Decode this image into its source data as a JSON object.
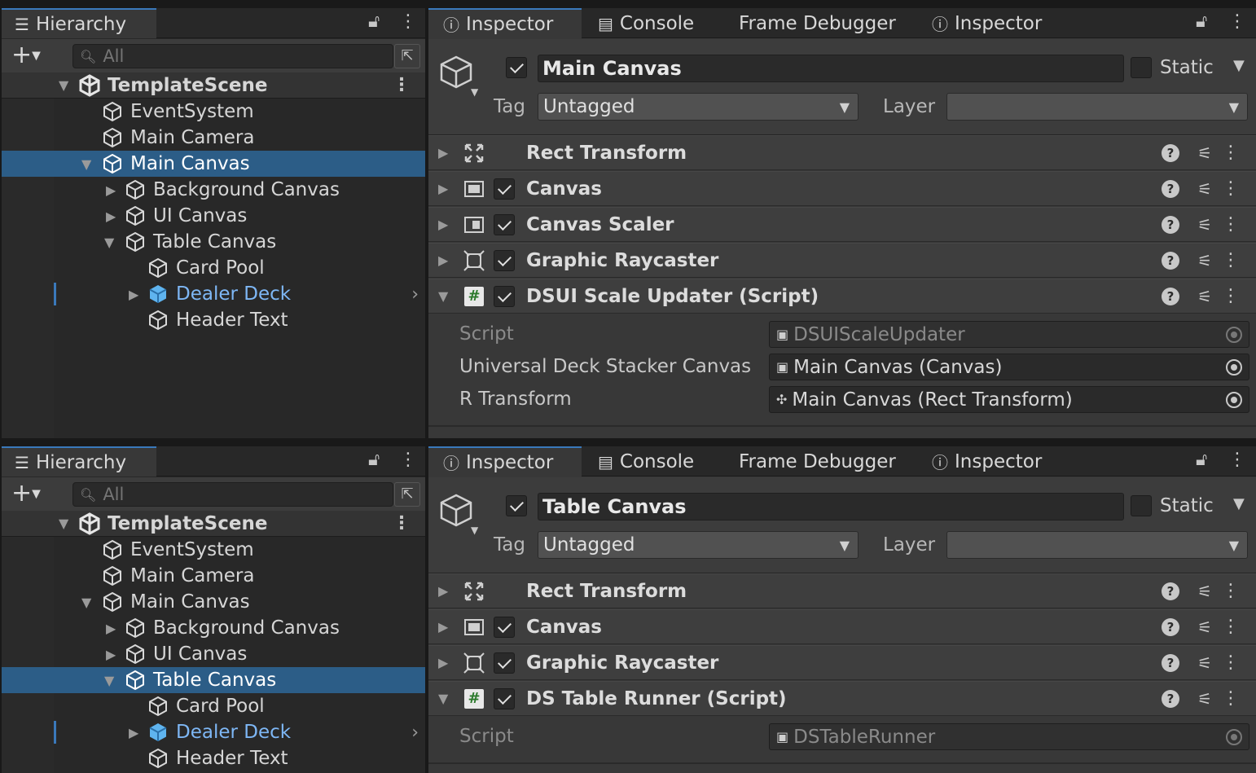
{
  "icons": {
    "hierarchy": "hierarchy-list-icon",
    "info": "info-icon",
    "console": "console-icon",
    "lock": "lock-icon",
    "kebab": "kebab-menu-icon",
    "cube": "gameobject-cube-icon",
    "unity": "unity-scene-icon"
  },
  "colors": {
    "selection": "#2c5d87",
    "prefab": "#7eb7f5",
    "tab_accent": "#3a79bb"
  },
  "panels": [
    {
      "hierarchy": {
        "tab": "Hierarchy",
        "search_placeholder": "All",
        "scene": "TemplateScene",
        "items": [
          {
            "label": "EventSystem"
          },
          {
            "label": "Main Camera"
          },
          {
            "label": "Main Canvas"
          },
          {
            "label": "Background Canvas"
          },
          {
            "label": "UI Canvas"
          },
          {
            "label": "Table Canvas"
          },
          {
            "label": "Card Pool"
          },
          {
            "label": "Dealer Deck"
          },
          {
            "label": "Header Text"
          }
        ]
      },
      "inspector": {
        "tabs": [
          "Inspector",
          "Console",
          "Frame Debugger",
          "Inspector"
        ],
        "object_name": "Main Canvas",
        "static_label": "Static",
        "tag_label": "Tag",
        "tag_value": "Untagged",
        "layer_label": "Layer",
        "layer_value": "",
        "components": [
          {
            "name": "Rect Transform"
          },
          {
            "name": "Canvas"
          },
          {
            "name": "Canvas Scaler"
          },
          {
            "name": "Graphic Raycaster"
          },
          {
            "name": "DSUI Scale Updater (Script)"
          }
        ],
        "properties": [
          {
            "label": "Script",
            "value": "DSUIScaleUpdater"
          },
          {
            "label": "Universal Deck Stacker Canvas",
            "value": "Main Canvas (Canvas)"
          },
          {
            "label": "R Transform",
            "value": "Main Canvas (Rect Transform)"
          }
        ]
      }
    },
    {
      "hierarchy": {
        "tab": "Hierarchy",
        "search_placeholder": "All",
        "scene": "TemplateScene",
        "items": [
          {
            "label": "EventSystem"
          },
          {
            "label": "Main Camera"
          },
          {
            "label": "Main Canvas"
          },
          {
            "label": "Background Canvas"
          },
          {
            "label": "UI Canvas"
          },
          {
            "label": "Table Canvas"
          },
          {
            "label": "Card Pool"
          },
          {
            "label": "Dealer Deck"
          },
          {
            "label": "Header Text"
          }
        ]
      },
      "inspector": {
        "tabs": [
          "Inspector",
          "Console",
          "Frame Debugger",
          "Inspector"
        ],
        "object_name": "Table Canvas",
        "static_label": "Static",
        "tag_label": "Tag",
        "tag_value": "Untagged",
        "layer_label": "Layer",
        "layer_value": "",
        "components": [
          {
            "name": "Rect Transform"
          },
          {
            "name": "Canvas"
          },
          {
            "name": "Graphic Raycaster"
          },
          {
            "name": "DS Table Runner (Script)"
          }
        ],
        "properties": [
          {
            "label": "Script",
            "value": "DSTableRunner"
          }
        ]
      }
    }
  ]
}
